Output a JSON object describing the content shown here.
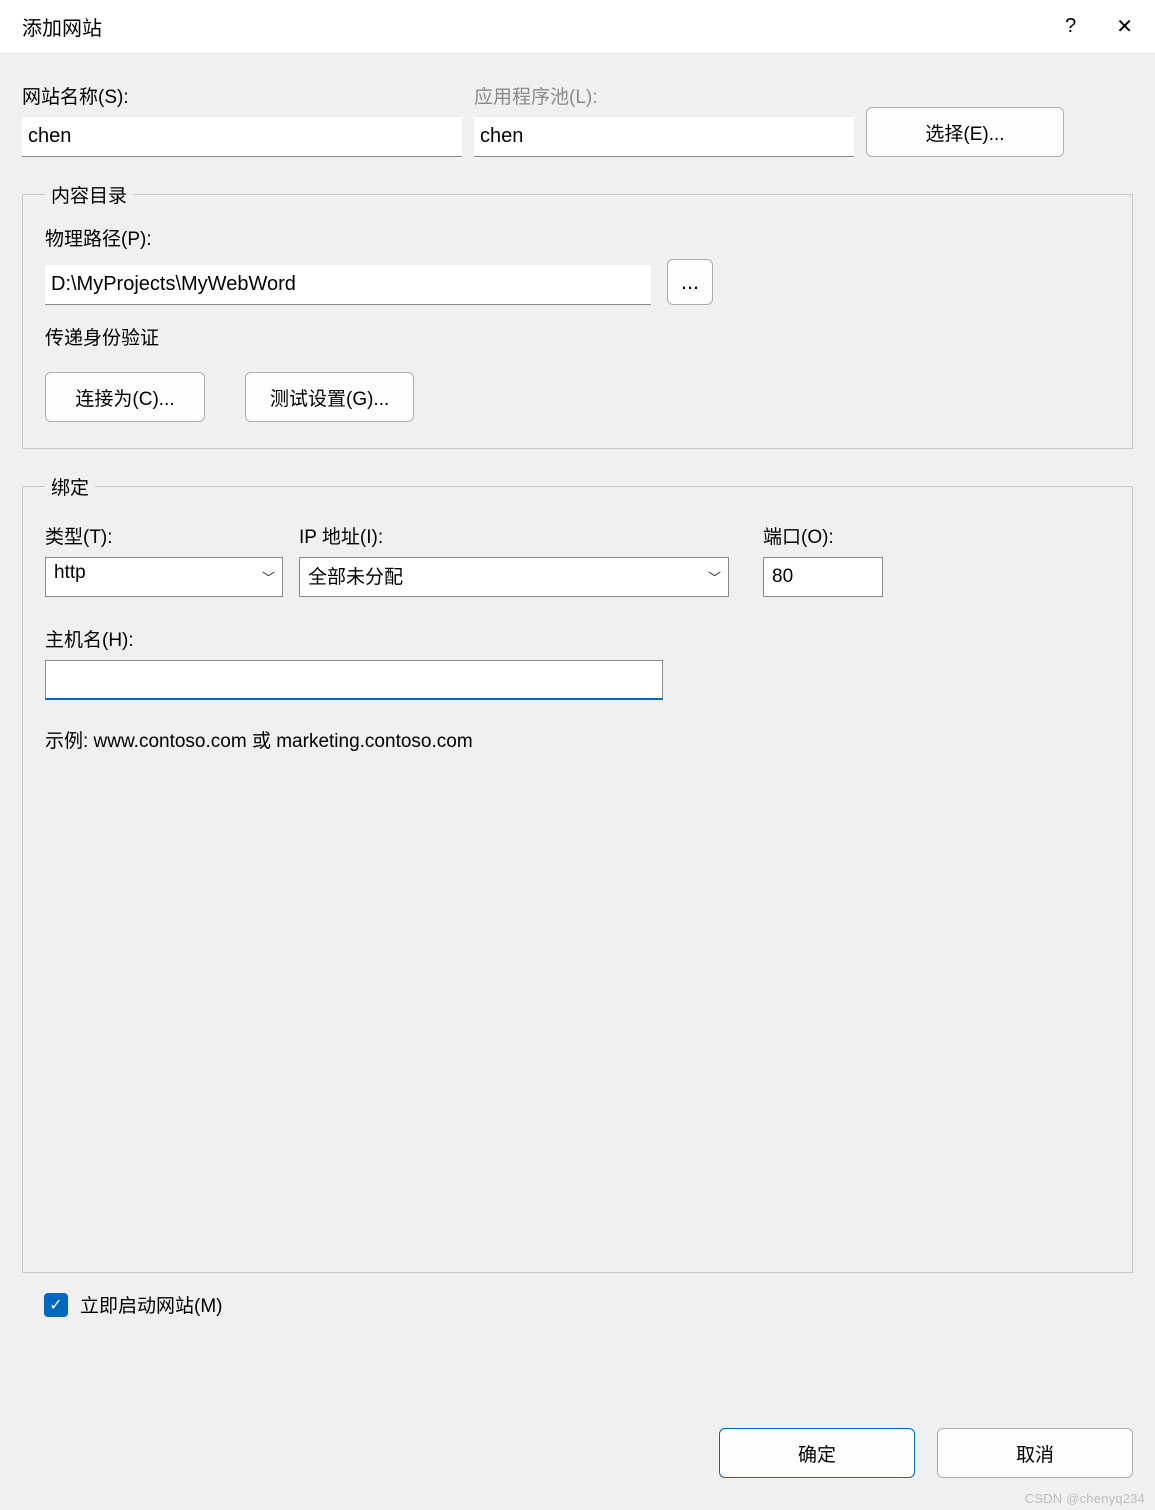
{
  "titlebar": {
    "title": "添加网站",
    "help_icon": "?",
    "close_icon": "✕"
  },
  "top": {
    "site_name_label": "网站名称(S):",
    "site_name_value": "chen",
    "app_pool_label": "应用程序池(L):",
    "app_pool_value": "chen",
    "select_button": "选择(E)..."
  },
  "content_dir": {
    "legend": "内容目录",
    "physical_path_label": "物理路径(P):",
    "physical_path_value": "D:\\MyProjects\\MyWebWord",
    "browse_button": "...",
    "pass_auth_label": "传递身份验证",
    "connect_as_button": "连接为(C)...",
    "test_settings_button": "测试设置(G)..."
  },
  "binding": {
    "legend": "绑定",
    "type_label": "类型(T):",
    "type_value": "http",
    "ip_label": "IP 地址(I):",
    "ip_value": "全部未分配",
    "port_label": "端口(O):",
    "port_value": "80",
    "hostname_label": "主机名(H):",
    "hostname_value": "",
    "example_text": "示例: www.contoso.com 或 marketing.contoso.com"
  },
  "start_immediately": {
    "checked": true,
    "label": "立即启动网站(M)"
  },
  "footer": {
    "ok": "确定",
    "cancel": "取消"
  },
  "watermark": "CSDN @chenyq234"
}
